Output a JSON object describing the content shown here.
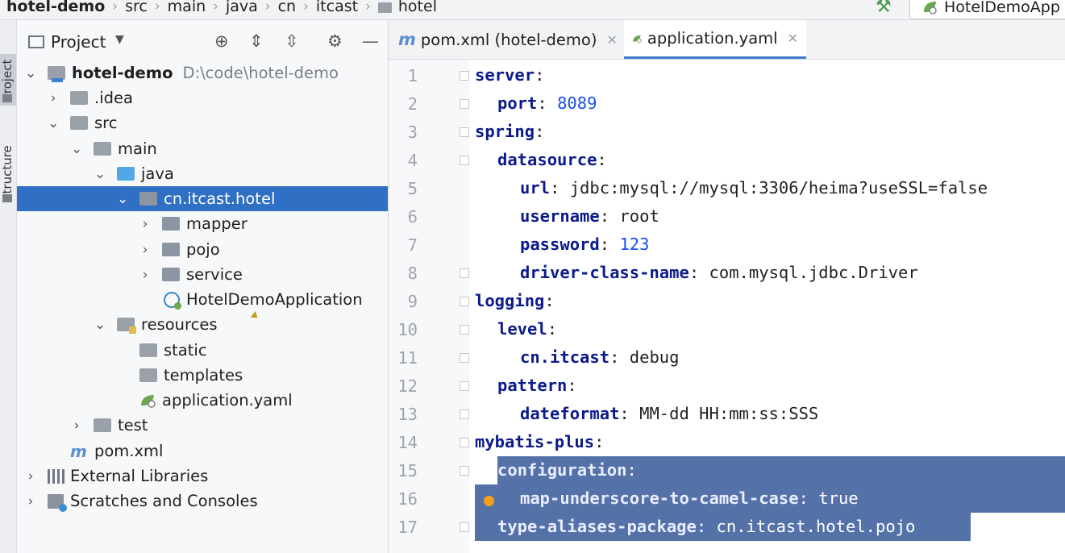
{
  "breadcrumb": {
    "items": [
      "hotel-demo",
      "src",
      "main",
      "java",
      "cn",
      "itcast",
      "hotel"
    ]
  },
  "run_config": {
    "label": "HotelDemoApp"
  },
  "side_strip": {
    "project_tab": "Project",
    "structure_tab": "Structure"
  },
  "project_panel": {
    "title": "Project",
    "tree": [
      {
        "label": "hotel-demo",
        "path": "D:\\code\\hotel-demo",
        "expanded": true
      },
      {
        "label": ".idea",
        "expanded": false
      },
      {
        "label": "src",
        "expanded": true
      },
      {
        "label": "main",
        "expanded": true
      },
      {
        "label": "java",
        "expanded": true
      },
      {
        "label": "cn.itcast.hotel",
        "expanded": true,
        "selected": true
      },
      {
        "label": "mapper",
        "expanded": false
      },
      {
        "label": "pojo",
        "expanded": false
      },
      {
        "label": "service",
        "expanded": false
      },
      {
        "label": "HotelDemoApplication"
      },
      {
        "label": "resources",
        "expanded": true
      },
      {
        "label": "static"
      },
      {
        "label": "templates"
      },
      {
        "label": "application.yaml"
      },
      {
        "label": "test",
        "expanded": false
      },
      {
        "label": "pom.xml"
      },
      {
        "label": "External Libraries",
        "expanded": false
      },
      {
        "label": "Scratches and Consoles",
        "expanded": false
      }
    ]
  },
  "editor": {
    "tabs": [
      {
        "label": "pom.xml (hotel-demo)",
        "active": false
      },
      {
        "label": "application.yaml",
        "active": true
      }
    ],
    "lines": [
      {
        "n": "1",
        "key": "server",
        "sep": ":",
        "value": ""
      },
      {
        "n": "2",
        "key": "port",
        "sep": ": ",
        "value": "8089"
      },
      {
        "n": "3",
        "key": "spring",
        "sep": ":",
        "value": ""
      },
      {
        "n": "4",
        "key": "datasource",
        "sep": ":",
        "value": ""
      },
      {
        "n": "5",
        "key": "url",
        "sep": ": ",
        "value": "jdbc:mysql://mysql:3306/heima?useSSL=false"
      },
      {
        "n": "6",
        "key": "username",
        "sep": ": ",
        "value": "root"
      },
      {
        "n": "7",
        "key": "password",
        "sep": ": ",
        "value": "123"
      },
      {
        "n": "8",
        "key": "driver-class-name",
        "sep": ": ",
        "value": "com.mysql.jdbc.Driver"
      },
      {
        "n": "9",
        "key": "logging",
        "sep": ":",
        "value": ""
      },
      {
        "n": "10",
        "key": "level",
        "sep": ":",
        "value": ""
      },
      {
        "n": "11",
        "key": "cn.itcast",
        "sep": ": ",
        "value": "debug"
      },
      {
        "n": "12",
        "key": "pattern",
        "sep": ":",
        "value": ""
      },
      {
        "n": "13",
        "key": "dateformat",
        "sep": ": ",
        "value": "MM-dd HH:mm:ss:SSS"
      },
      {
        "n": "14",
        "key": "mybatis-plus",
        "sep": ":",
        "value": ""
      },
      {
        "n": "15",
        "key": "configuration",
        "sep": ":",
        "value": ""
      },
      {
        "n": "16",
        "key": "map-underscore-to-camel-case",
        "sep": ": ",
        "value": "true"
      },
      {
        "n": "17",
        "key": "type-aliases-package",
        "sep": ": ",
        "value": "cn.itcast.hotel.pojo"
      }
    ]
  },
  "colors": {
    "selection": "#5572a8",
    "tree_selection": "#2f6fc4",
    "yaml_key": "#0b1a8c"
  }
}
